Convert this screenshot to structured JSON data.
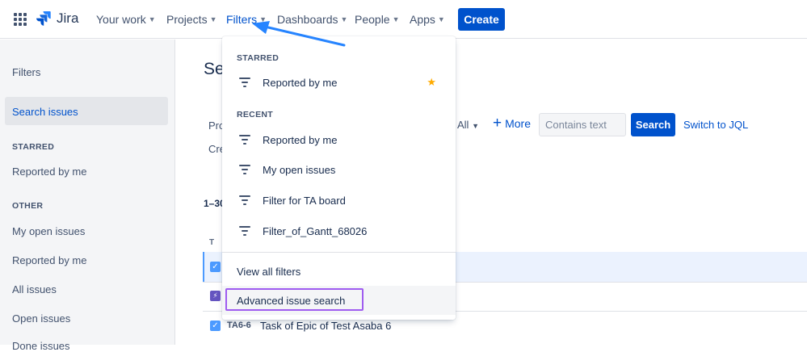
{
  "topnav": {
    "logo_text": "Jira",
    "items": [
      {
        "label": "Your work"
      },
      {
        "label": "Projects"
      },
      {
        "label": "Filters"
      },
      {
        "label": "Dashboards"
      },
      {
        "label": "People"
      },
      {
        "label": "Apps"
      }
    ],
    "create_label": "Create"
  },
  "sidebar": {
    "title": "Filters",
    "selected": "Search issues",
    "starred_heading": "STARRED",
    "starred": [
      "Reported by me"
    ],
    "other_heading": "OTHER",
    "other": [
      "My open issues",
      "Reported by me",
      "All issues",
      "Open issues",
      "Done issues"
    ]
  },
  "main": {
    "title_fragment": "Se",
    "filter_fragment_1": "Pro",
    "filter_fragment_2": "Cre",
    "all_dropdown": "All",
    "more_label": "More",
    "search_placeholder": "Contains text",
    "search_button": "Search",
    "switch_jql": "Switch to JQL",
    "count_fragment": "1–30",
    "column_type": "T",
    "issue_row": {
      "key": "TA6-6",
      "summary": "Task of Epic of Test Asaba 6"
    }
  },
  "dropdown": {
    "starred_heading": "STARRED",
    "starred": [
      {
        "label": "Reported by me",
        "starred": true
      }
    ],
    "recent_heading": "RECENT",
    "recent": [
      "Reported by me",
      "My open issues",
      "Filter for TA board",
      "Filter_of_Gantt_68026"
    ],
    "view_all": "View all filters",
    "advanced": "Advanced issue search"
  },
  "colors": {
    "brand": "#0052cc",
    "annotation_arrow": "#2684ff",
    "highlight_box": "#9f5cf0",
    "star": "#ffab00"
  }
}
